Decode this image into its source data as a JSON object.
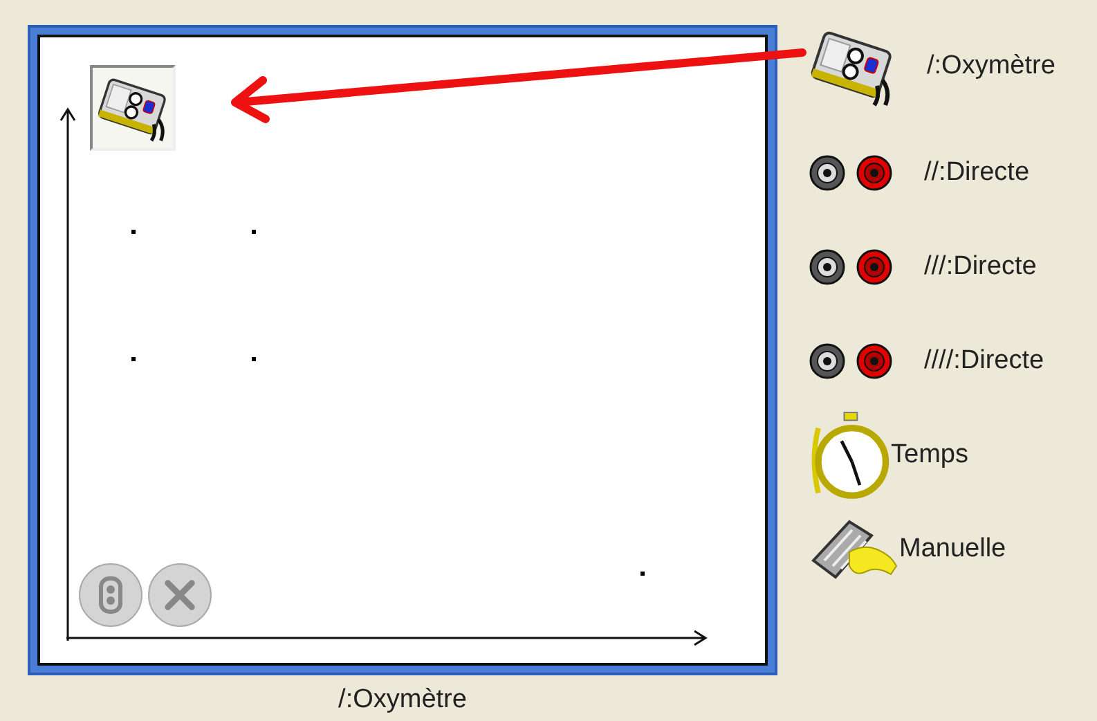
{
  "graph": {
    "caption": "/:Oxymètre"
  },
  "sources": [
    {
      "kind": "device",
      "label": "/:Oxymètre"
    },
    {
      "kind": "channel",
      "label": "//:Directe"
    },
    {
      "kind": "channel",
      "label": "///:Directe"
    },
    {
      "kind": "channel",
      "label": "////:Directe"
    },
    {
      "kind": "time",
      "label": "Temps"
    },
    {
      "kind": "manual",
      "label": "Manuelle"
    }
  ]
}
